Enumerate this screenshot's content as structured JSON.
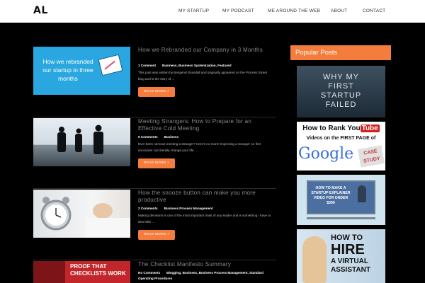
{
  "header": {
    "logo": "AL",
    "nav": [
      "MY STARTUP",
      "MY PODCAST",
      "ME AROUND THE WEB",
      "ABOUT",
      "CONTACT"
    ]
  },
  "posts": [
    {
      "title": "How we Rebranded our Company in 3 Months",
      "meta": [
        "1 Comment",
        "Business, Business Systemization, Featured"
      ],
      "excerpt": "This post was written by Benjamin Brandall and originally appeared on the Process Street blog and is the story of ...",
      "read_more": "READ MORE »",
      "thumb_text": "How we rebranded our startup in three months"
    },
    {
      "title": "Meeting Strangers: How to Prepare for an Effective Cold Meeting",
      "meta": [
        "9 Comments",
        "Business"
      ],
      "excerpt": "Ever been nervous meeting a stranger? Here's no more! Improving a stranger on first encounter can literally change your life. ...",
      "read_more": "READ MORE »"
    },
    {
      "title": "How the snooze button can make you more productive",
      "meta": [
        "2 Comments",
        "Business Process Management"
      ],
      "excerpt": "Making decisions is one of the most important traits of any leader and is something I have to deal with ...",
      "read_more": "READ MORE »"
    },
    {
      "title": "The Checklist Manifesto Summary",
      "meta": [
        "No Comments",
        "Blogging, Business, Business Process Management, Standard Operating Procedures"
      ],
      "thumb_text": "PROOF THAT CHECKLISTS WORK"
    }
  ],
  "sidebar": {
    "heading": "Popular Posts",
    "items": [
      {
        "text": "WHY MY FIRST STARTUP FAILED"
      },
      {
        "line1": "How to Rank You",
        "brand": "Tube",
        "line2": "Videos on the FIRST PAGE of",
        "google": "Google",
        "badge1": "CASE",
        "badge2": "STUDY"
      },
      {
        "text": "HOW TO MAKE A STARTUP EXPLAINER VIDEO FOR UNDER $300"
      },
      {
        "line1": "HOW TO",
        "line2": "HIRE",
        "line3": "A VIRTUAL",
        "line4": "ASSISTANT"
      }
    ]
  }
}
